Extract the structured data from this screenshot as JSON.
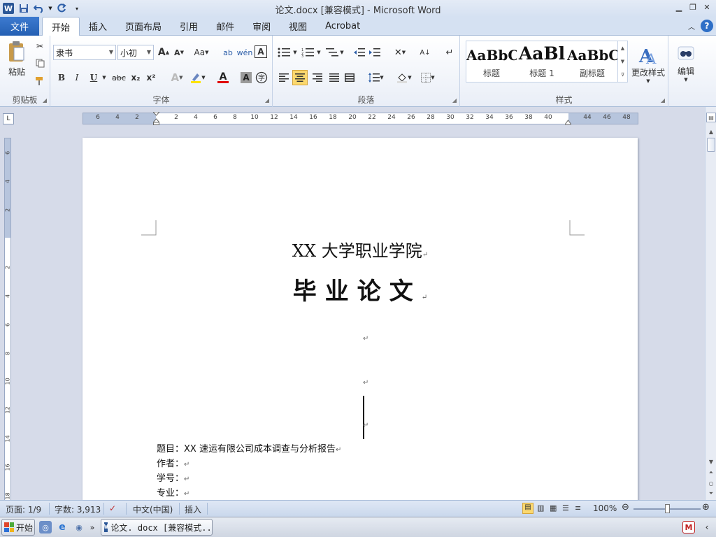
{
  "window": {
    "title": "论文.docx [兼容模式] - Microsoft Word",
    "app_icon_letter": "W"
  },
  "tabs": {
    "file": "文件",
    "items": [
      "开始",
      "插入",
      "页面布局",
      "引用",
      "邮件",
      "审阅",
      "视图",
      "Acrobat"
    ],
    "active": "开始"
  },
  "ribbon": {
    "clipboard": {
      "paste": "粘贴",
      "label": "剪贴板"
    },
    "font": {
      "family": "隶书",
      "size": "小初",
      "grow": "A",
      "shrink": "A",
      "change_case": "Aa",
      "bold": "B",
      "italic": "I",
      "underline": "U",
      "strike": "abc",
      "subscript": "x₂",
      "superscript": "x²",
      "label": "字体"
    },
    "paragraph": {
      "label": "段落"
    },
    "styles": {
      "items": [
        {
          "sample": "AaBbC",
          "name": "标题"
        },
        {
          "sample": "AaBl",
          "name": "标题 1"
        },
        {
          "sample": "AaBbC",
          "name": "副标题"
        }
      ],
      "change_styles": "更改样式",
      "label": "样式"
    },
    "editing": {
      "label": "编辑"
    }
  },
  "ruler": {
    "h_ticks": [
      "6",
      "4",
      "2",
      "",
      "2",
      "4",
      "6",
      "8",
      "10",
      "12",
      "14",
      "16",
      "18",
      "20",
      "22",
      "24",
      "26",
      "28",
      "30",
      "32",
      "34",
      "36",
      "38",
      "40",
      "",
      "44",
      "46",
      "48"
    ],
    "v_ticks": [
      "6",
      "4",
      "2",
      "",
      "2",
      "4",
      "6",
      "8",
      "10",
      "12",
      "14",
      "16",
      "18"
    ]
  },
  "document": {
    "university": "XX 大学职业学院",
    "thesis_title": "毕业论文",
    "fields": [
      {
        "label": "题目：",
        "value": "XX 速运有限公司成本调查与分析报告"
      },
      {
        "label": "作者：",
        "value": ""
      },
      {
        "label": "学号：",
        "value": ""
      },
      {
        "label": "专业：",
        "value": ""
      }
    ],
    "para_mark": "↵"
  },
  "statusbar": {
    "page": "页面: 1/9",
    "words": "字数: 3,913",
    "language": "中文(中国)",
    "mode": "插入",
    "zoom": "100%"
  },
  "taskbar": {
    "start": "开始",
    "task_item": "论文. docx [兼容模式..."
  }
}
